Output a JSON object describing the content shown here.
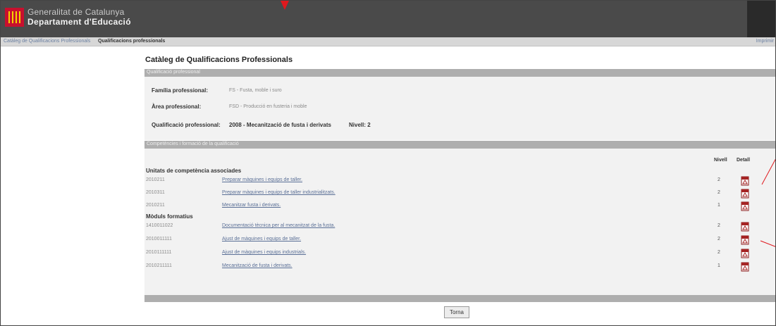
{
  "header": {
    "brand_line1": "Generalitat de Catalunya",
    "brand_line2": "Departament d'Educació"
  },
  "breadcrumb": {
    "parent": "Catàleg de Qualificacions Professionals",
    "current": "Qualificacions professionals",
    "right": "Imprimir"
  },
  "page": {
    "title": "Catàleg de Qualificacions Professionals"
  },
  "qualification": {
    "section_title": "Qualificació professional",
    "family_label": "Família professional:",
    "family_value": "FS - Fusta, moble i suro",
    "area_label": "Àrea professional:",
    "area_value": "FSD - Producció en fusteria i moble",
    "qual_label": "Qualificació professional:",
    "qual_value": "2008 - Mecanització de fusta i derivats",
    "level_text": "Nivell: 2"
  },
  "competences": {
    "section_title": "Competències i formació de la qualificació",
    "col_level": "Nivell",
    "col_detail": "Detall",
    "units_title": "Unitats de competència associades",
    "units": [
      {
        "code": "2010211",
        "name": "Preparar màquines i equips de taller.",
        "level": "2"
      },
      {
        "code": "2010311",
        "name": "Preparar màquines i equips de taller industrialitzats.",
        "level": "2"
      },
      {
        "code": "2010211",
        "name": "Mecanitzar fusta i derivats.",
        "level": "1"
      }
    ],
    "modules_title": "Mòduls formatius",
    "modules": [
      {
        "code": "1410011022",
        "name": "Documentació tècnica per al mecanitzat de la fusta.",
        "level": "2"
      },
      {
        "code": "2010011111",
        "name": "Ajust de màquines i equips de taller.",
        "level": "2"
      },
      {
        "code": "2010111111",
        "name": "Ajust de màquines i equips industrials.",
        "level": "2"
      },
      {
        "code": "2010211111",
        "name": "Mecanització de fusta i derivats.",
        "level": "1"
      }
    ]
  },
  "actions": {
    "back_label": "Torna"
  },
  "colors": {
    "header_bg": "#4a4a4a",
    "section_bar": "#aeaeae",
    "panel_bg": "#f2f2f2",
    "link": "#5a6f96",
    "logo_red": "#c8102e",
    "annotation_red": "#e0191e"
  },
  "icons": {
    "logo": "generalitat-logo-icon",
    "detail": "pdf-icon",
    "annotation": "red-arrow-icon"
  }
}
